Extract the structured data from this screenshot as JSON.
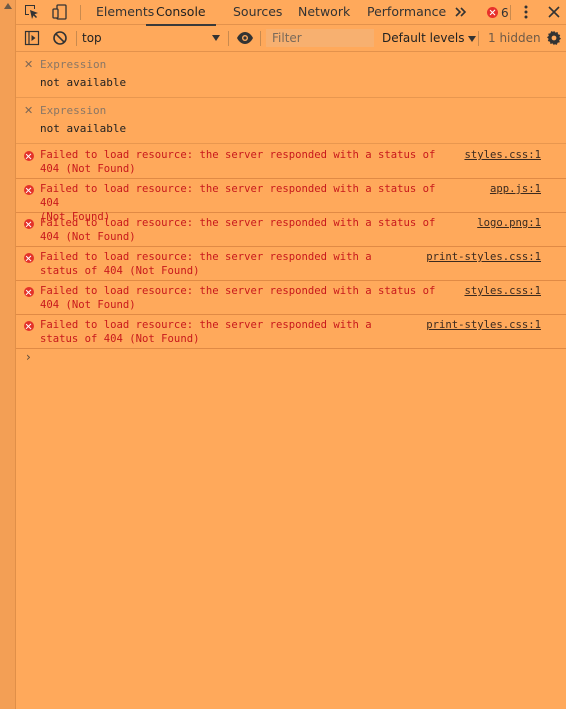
{
  "tabs": [
    {
      "label": "Elements"
    },
    {
      "label": "Console"
    },
    {
      "label": "Sources"
    },
    {
      "label": "Network"
    },
    {
      "label": "Performance"
    }
  ],
  "active_tab": "Console",
  "error_count": "6",
  "toolbar": {
    "context": "top",
    "filter_placeholder": "Filter",
    "levels": "Default levels",
    "hidden": "1 hidden"
  },
  "expressions": [
    {
      "label": "Expression",
      "value": "not available"
    },
    {
      "label": "Expression",
      "value": "not available"
    }
  ],
  "messages": [
    {
      "text": "Failed to load resource: the server responded with a status of\n404 (Not Found)",
      "source": "styles.css:1"
    },
    {
      "text": "Failed to load resource: the server responded with a status of 404\n(Not Found)",
      "source": "app.js:1"
    },
    {
      "text": "Failed to load resource: the server responded with a status of\n404 (Not Found)",
      "source": "logo.png:1"
    },
    {
      "text": "Failed to load resource: the server responded with a\nstatus of 404 (Not Found)",
      "source": "print-styles.css:1"
    },
    {
      "text": "Failed to load resource: the server responded with a status of\n404 (Not Found)",
      "source": "styles.css:1"
    },
    {
      "text": "Failed to load resource: the server responded with a\nstatus of 404 (Not Found)",
      "source": "print-styles.css:1"
    }
  ],
  "colors": {
    "background": "#ffa95b",
    "error_text": "#c8191c",
    "error_icon": "#e3322a"
  }
}
